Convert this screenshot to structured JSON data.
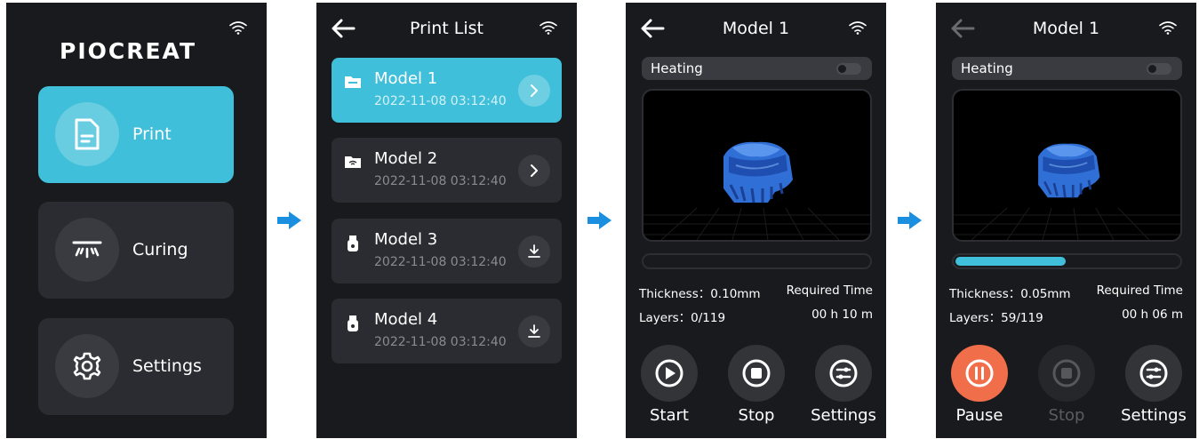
{
  "colors": {
    "accent": "#3fbfd9",
    "pause": "#f06e4a",
    "screen_bg": "#191a1d",
    "card_bg": "#2b2c31"
  },
  "home": {
    "logo": "PIOCREAT",
    "menu": [
      {
        "label": "Print",
        "icon": "document-icon",
        "active": true
      },
      {
        "label": "Curing",
        "icon": "uv-lamp-icon",
        "active": false
      },
      {
        "label": "Settings",
        "icon": "gear-icon",
        "active": false
      }
    ]
  },
  "print_list": {
    "title": "Print List",
    "items": [
      {
        "name": "Model 1",
        "date": "2022-11-08 03:12:40",
        "source_icon": "folder-icon",
        "action_icon": "chevron-right-icon",
        "active": true
      },
      {
        "name": "Model 2",
        "date": "2022-11-08 03:12:40",
        "source_icon": "wifi-folder-icon",
        "action_icon": "chevron-right-icon",
        "active": false
      },
      {
        "name": "Model 3",
        "date": "2022-11-08 03:12:40",
        "source_icon": "usb-icon",
        "action_icon": "download-icon",
        "active": false
      },
      {
        "name": "Model 4",
        "date": "2022-11-08 03:12:40",
        "source_icon": "usb-icon",
        "action_icon": "download-icon",
        "active": false
      }
    ]
  },
  "model_ready": {
    "title": "Model 1",
    "heating_label": "Heating",
    "heating_on": false,
    "progress": 0,
    "thickness": "Thickness：0.10mm",
    "layers": "Layers：0/119",
    "time_label": "Required Time",
    "time_value": "00 h 10 m",
    "buttons": [
      {
        "label": "Start",
        "icon": "play-icon",
        "state": "normal"
      },
      {
        "label": "Stop",
        "icon": "stop-icon",
        "state": "normal"
      },
      {
        "label": "Settings",
        "icon": "adjust-icon",
        "state": "normal"
      }
    ]
  },
  "model_printing": {
    "title": "Model 1",
    "heating_label": "Heating",
    "heating_on": false,
    "progress": 0.496,
    "thickness": "Thickness：0.05mm",
    "layers": "Layers：59/119",
    "time_label": "Required Time",
    "time_value": "00 h 06 m",
    "buttons": [
      {
        "label": "Pause",
        "icon": "pause-icon",
        "state": "active"
      },
      {
        "label": "Stop",
        "icon": "stop-icon",
        "state": "disabled"
      },
      {
        "label": "Settings",
        "icon": "adjust-icon",
        "state": "normal"
      }
    ]
  }
}
